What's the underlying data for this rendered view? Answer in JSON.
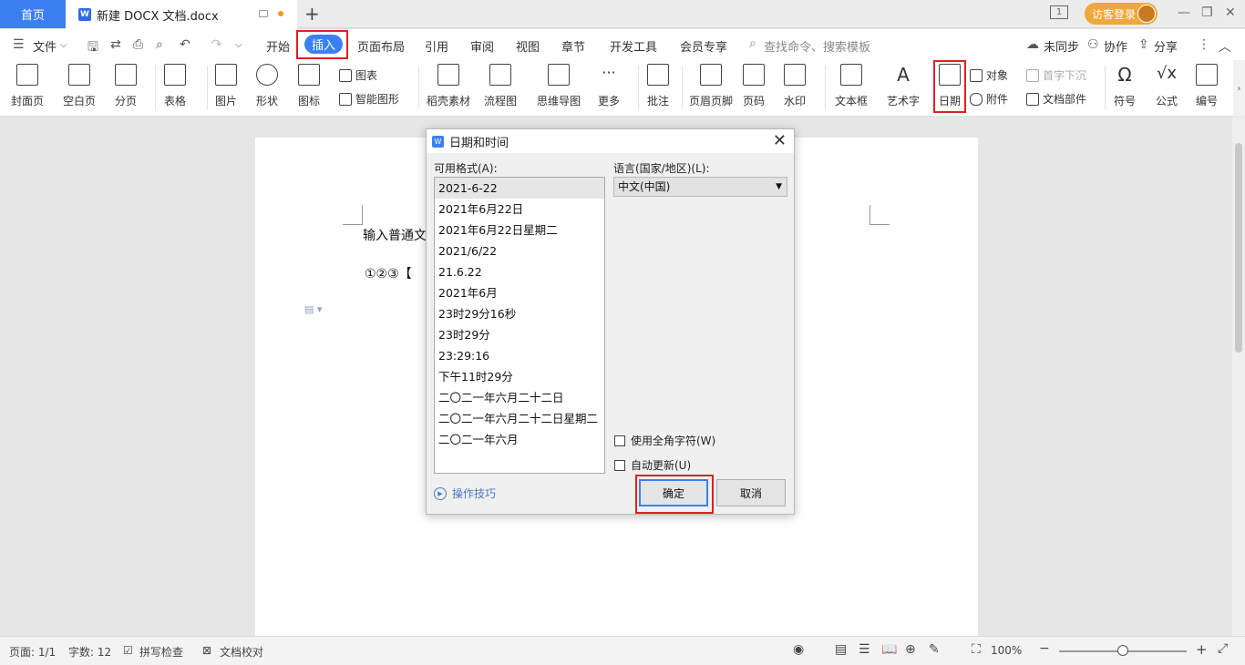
{
  "tabbar": {
    "home": "首页",
    "doc_title": "新建 DOCX 文档.docx",
    "doc_logo": "W",
    "new_tab": "+",
    "page_indicator": "1",
    "login": "访客登录"
  },
  "menu": {
    "file": "文件",
    "items": [
      "开始",
      "插入",
      "页面布局",
      "引用",
      "审阅",
      "视图",
      "章节",
      "开发工具",
      "会员专享"
    ],
    "search": "查找命令、搜索模板",
    "sync": "未同步",
    "collab": "协作",
    "share": "分享"
  },
  "ribbon": {
    "cover": "封面页",
    "blank": "空白页",
    "pagebreak": "分页",
    "table": "表格",
    "picture": "图片",
    "shape": "形状",
    "icon": "图标",
    "chart": "图表",
    "smartart": "智能图形",
    "material": "稻壳素材",
    "flowchart": "流程图",
    "mindmap": "思维导图",
    "more": "更多",
    "comment": "批注",
    "header_footer": "页眉页脚",
    "page_number": "页码",
    "watermark": "水印",
    "textbox": "文本框",
    "wordart": "艺术字",
    "date": "日期",
    "object": "对象",
    "dropcap": "首字下沉",
    "attachment": "附件",
    "docpart": "文档部件",
    "symbol": "符号",
    "formula": "公式",
    "numbering": "编号"
  },
  "document": {
    "line1": "输入普通文",
    "line2": "①②③【"
  },
  "dialog": {
    "title": "日期和时间",
    "formats_label": "可用格式(A):",
    "formats": [
      "2021-6-22",
      "2021年6月22日",
      "2021年6月22日星期二",
      "2021/6/22",
      "21.6.22",
      "2021年6月",
      "23时29分16秒",
      "23时29分",
      "23:29:16",
      "下午11时29分",
      "二〇二一年六月二十二日",
      "二〇二一年六月二十二日星期二",
      "二〇二一年六月"
    ],
    "language_label": "语言(国家/地区)(L):",
    "language_value": "中文(中国)",
    "fullwidth": "使用全角字符(W)",
    "autoupdate": "自动更新(U)",
    "tips": "操作技巧",
    "ok": "确定",
    "cancel": "取消"
  },
  "status": {
    "page": "页面: 1/1",
    "words": "字数: 12",
    "spell": "拼写检查",
    "proof": "文档校对",
    "zoom": "100%"
  }
}
